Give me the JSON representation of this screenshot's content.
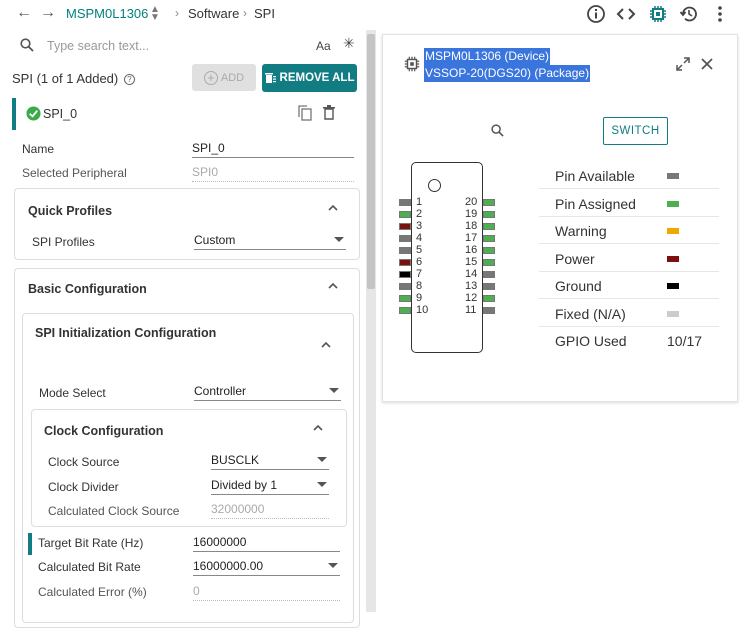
{
  "topbar": {
    "device": "MSPM0L1306",
    "crumbs": [
      "Software",
      "SPI"
    ]
  },
  "search": {
    "placeholder": "Type search text...",
    "case_label": "Aa"
  },
  "module": {
    "header": "SPI (1 of 1 Added)",
    "add_label": "ADD",
    "remove_all_label": "REMOVE ALL",
    "instance_name": "SPI_0"
  },
  "fields": {
    "name_label": "Name",
    "name_value": "SPI_0",
    "peripheral_label": "Selected Peripheral",
    "peripheral_value": "SPI0"
  },
  "quick_profiles": {
    "title": "Quick Profiles",
    "profiles_label": "SPI Profiles",
    "profiles_value": "Custom"
  },
  "basic": {
    "title": "Basic Configuration",
    "init_title": "SPI Initialization Configuration",
    "mode_label": "Mode Select",
    "mode_value": "Controller",
    "clock": {
      "title": "Clock Configuration",
      "source_label": "Clock Source",
      "source_value": "BUSCLK",
      "divider_label": "Clock Divider",
      "divider_value": "Divided by 1",
      "calc_label": "Calculated Clock Source",
      "calc_value": "32000000"
    },
    "target_label": "Target Bit Rate (Hz)",
    "target_value": "16000000",
    "calc_bitrate_label": "Calculated Bit Rate",
    "calc_bitrate_value": "16000000.00",
    "calc_error_label": "Calculated Error (%)",
    "calc_error_value": "0"
  },
  "device_panel": {
    "line1": "MSPM0L1306 (Device)",
    "line2": "VSSOP-20(DGS20) (Package)",
    "switch_label": "SWITCH",
    "pins_left": [
      {
        "num": "1",
        "color": "#777777"
      },
      {
        "num": "2",
        "color": "#4caf50"
      },
      {
        "num": "3",
        "color": "#7a1010"
      },
      {
        "num": "4",
        "color": "#777777"
      },
      {
        "num": "5",
        "color": "#777777"
      },
      {
        "num": "6",
        "color": "#7a1010"
      },
      {
        "num": "7",
        "color": "#000000"
      },
      {
        "num": "8",
        "color": "#777777"
      },
      {
        "num": "9",
        "color": "#4caf50"
      },
      {
        "num": "10",
        "color": "#4caf50"
      }
    ],
    "pins_right": [
      {
        "num": "20",
        "color": "#4caf50"
      },
      {
        "num": "19",
        "color": "#4caf50"
      },
      {
        "num": "18",
        "color": "#4caf50"
      },
      {
        "num": "17",
        "color": "#4caf50"
      },
      {
        "num": "16",
        "color": "#4caf50"
      },
      {
        "num": "15",
        "color": "#4caf50"
      },
      {
        "num": "14",
        "color": "#777777"
      },
      {
        "num": "13",
        "color": "#777777"
      },
      {
        "num": "12",
        "color": "#4caf50"
      },
      {
        "num": "11",
        "color": "#777777"
      }
    ],
    "legend": [
      {
        "label": "Pin Available",
        "color": "#777777"
      },
      {
        "label": "Pin Assigned",
        "color": "#4caf50"
      },
      {
        "label": "Warning",
        "color": "#f0a800"
      },
      {
        "label": "Power",
        "color": "#7a1010"
      },
      {
        "label": "Ground",
        "color": "#000000"
      },
      {
        "label": "Fixed (N/A)",
        "color": "#cccccc"
      }
    ],
    "gpio_label": "GPIO Used",
    "gpio_value": "10/17"
  }
}
